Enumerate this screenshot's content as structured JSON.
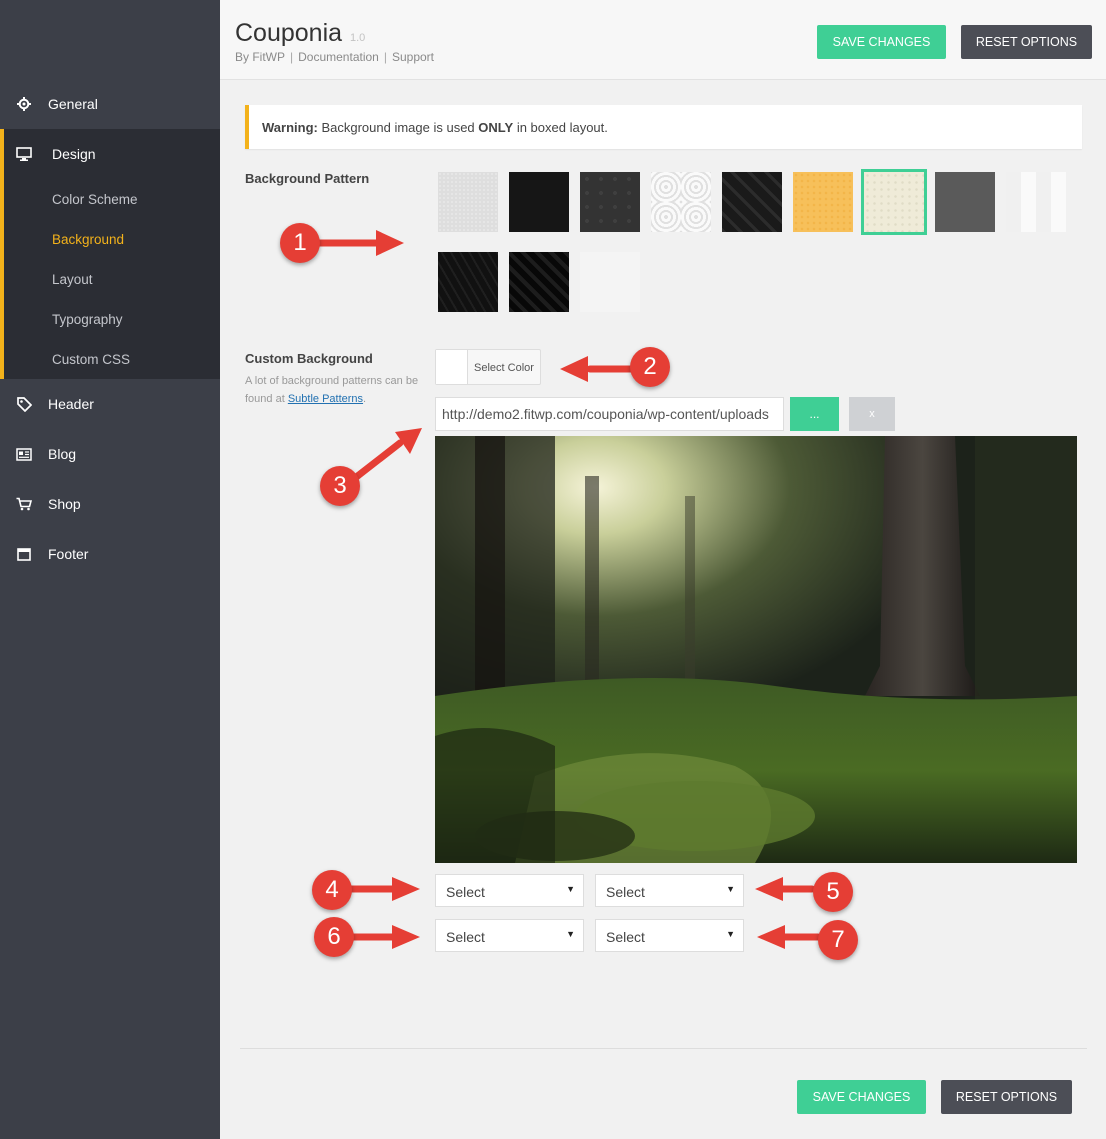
{
  "sidebar": {
    "items": [
      {
        "label": "General",
        "icon": "gear-icon"
      },
      {
        "label": "Design",
        "icon": "monitor-icon"
      },
      {
        "label": "Header",
        "icon": "tag-icon"
      },
      {
        "label": "Blog",
        "icon": "newspaper-icon"
      },
      {
        "label": "Shop",
        "icon": "cart-icon"
      },
      {
        "label": "Footer",
        "icon": "footer-icon"
      }
    ],
    "design_subitems": [
      "Color Scheme",
      "Background",
      "Layout",
      "Typography",
      "Custom CSS"
    ],
    "active_subitem": "Background"
  },
  "header": {
    "title": "Couponia",
    "version": "1.0",
    "by": "By FitWP",
    "documentation": "Documentation",
    "support": "Support",
    "save_label": "SAVE CHANGES",
    "reset_label": "RESET OPTIONS"
  },
  "warning": {
    "strong": "Warning:",
    "text_before": " Background image is used ",
    "emphasis": "ONLY",
    "text_after": " in boxed layout."
  },
  "background_pattern": {
    "label": "Background Pattern",
    "selected_index": 6
  },
  "custom_background": {
    "label": "Custom Background",
    "desc_before": "A lot of background patterns can be found at ",
    "desc_link": "Subtle Patterns",
    "desc_after": ".",
    "select_color_label": "Select Color",
    "url_value": "http://demo2.fitwp.com/couponia/wp-content/uploads",
    "upload_label": "...",
    "remove_label": "x",
    "selects": [
      "Select",
      "Select",
      "Select",
      "Select"
    ]
  },
  "markers": [
    "1",
    "2",
    "3",
    "4",
    "5",
    "6",
    "7"
  ],
  "footer": {
    "save_label": "SAVE CHANGES",
    "reset_label": "RESET OPTIONS"
  },
  "colors": {
    "accent_green": "#3fcf95",
    "accent_yellow": "#f3b21b",
    "sidebar_bg": "#3c3f48",
    "sidebar_active_bg": "#2b2d34",
    "marker_red": "#e53e35"
  }
}
